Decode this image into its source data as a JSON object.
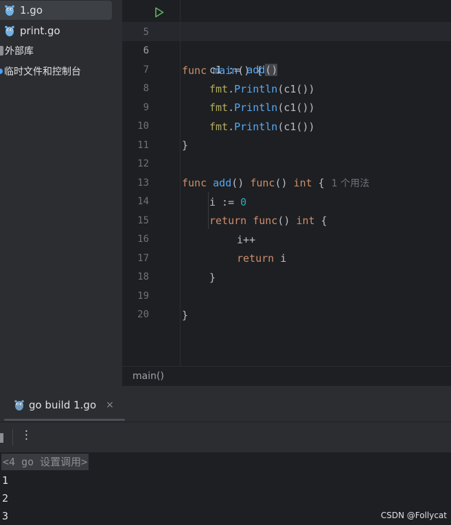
{
  "project": {
    "files": [
      {
        "name": "1.go",
        "icon": "gopher-icon"
      },
      {
        "name": "print.go",
        "icon": "gopher-icon"
      }
    ],
    "external_libraries": "外部库",
    "scratches": "临时文件和控制台"
  },
  "editor": {
    "line_numbers": [
      "5",
      "6",
      "7",
      "8",
      "9",
      "10",
      "11",
      "12",
      "13",
      "14",
      "15",
      "16",
      "17",
      "18",
      "19",
      "20"
    ],
    "current_line": "6",
    "usage_hint": "1 个用法",
    "breadcrumb": "main()",
    "code": {
      "l5": {
        "kw": "func",
        "name": "main",
        "rest": "() {"
      },
      "l6": {
        "a": "c1 := ",
        "call": "add",
        "b": "(",
        "c": ")"
      },
      "l7": {
        "pkg": "fmt",
        "dot": ".",
        "meth": "Println",
        "args": "(c1())"
      },
      "l8": {
        "pkg": "fmt",
        "dot": ".",
        "meth": "Println",
        "args": "(c1())"
      },
      "l9": {
        "pkg": "fmt",
        "dot": ".",
        "meth": "Println",
        "args": "(c1())"
      },
      "l10": "}",
      "l12": {
        "kw": "func",
        "name": "add",
        "p": "() ",
        "kw2": "func",
        "p2": "() ",
        "kw3": "int",
        "p3": " {"
      },
      "l13": {
        "a": "i := ",
        "num": "0"
      },
      "l14": {
        "kw": "return",
        "sp": " ",
        "kw2": "func",
        "p": "() ",
        "kw3": "int",
        "p2": " {"
      },
      "l15": "i++",
      "l16": {
        "kw": "return",
        "rest": " i"
      },
      "l17": "}",
      "l19": "}"
    }
  },
  "run": {
    "tab_label": "go build 1.go",
    "close": "×",
    "more_actions": "⋮",
    "command_line": "<4 go 设置调用>",
    "output": [
      "1",
      "2",
      "3"
    ]
  },
  "watermark": "CSDN @Follycat",
  "colors": {
    "keyword": "#cf8e6d",
    "function": "#56a8f5",
    "package": "#b3ae60",
    "number": "#2aacb8",
    "run_icon": "#5fb865"
  }
}
